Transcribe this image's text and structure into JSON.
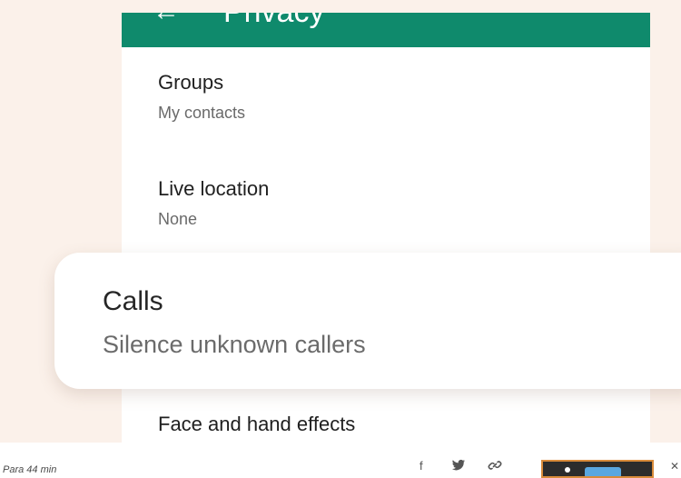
{
  "screen": {
    "header": {
      "back_icon": "back-arrow-icon",
      "title": "Privacy"
    },
    "items": [
      {
        "title": "Groups",
        "subtitle": "My contacts"
      },
      {
        "title": "Live location",
        "subtitle": "None"
      },
      {
        "title": "Face and hand effects"
      }
    ]
  },
  "callout": {
    "title": "Calls",
    "subtitle": "Silence unknown callers"
  },
  "footer": {
    "caption": "Para 44 min",
    "share_icons": [
      "facebook-icon",
      "twitter-icon",
      "link-icon"
    ],
    "close_icon": "close-icon"
  },
  "colors": {
    "app_bar": "#0f8a6c",
    "background": "#fbf1ea",
    "thumbnail_border": "#d98b3a"
  }
}
